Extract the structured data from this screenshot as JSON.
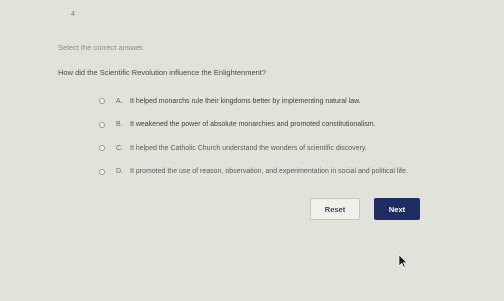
{
  "question": {
    "number": "4",
    "instruction": "Select the correct answer.",
    "prompt": "How did the Scientific Revolution influence the Enlightenment?"
  },
  "options": [
    {
      "letter": "A.",
      "text": "It helped monarchs rule their kingdoms better by implementing natural law."
    },
    {
      "letter": "B.",
      "text": "It weakened the power of absolute monarchies and promoted constitutionalism."
    },
    {
      "letter": "C.",
      "text": "It helped the Catholic Church understand the wonders of scientific discovery."
    },
    {
      "letter": "D.",
      "text": "It promoted the use of reason, observation, and experimentation in social and political life."
    }
  ],
  "buttons": {
    "reset_label": "Reset",
    "next_label": "Next"
  },
  "colors": {
    "background": "#e2e2da",
    "next_button": "#1f2d63",
    "reset_button": "#f1f1ec"
  },
  "icons": {
    "pointer": "mouse-pointer-icon"
  }
}
